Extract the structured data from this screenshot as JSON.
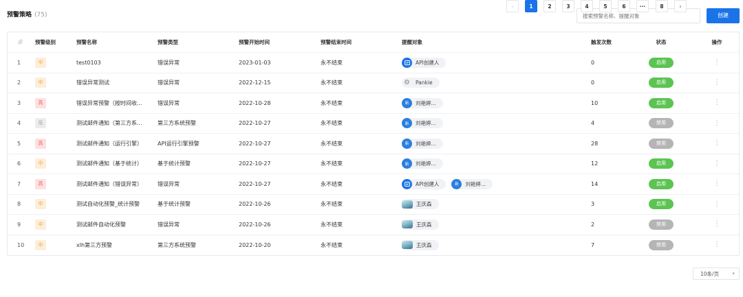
{
  "header": {
    "title": "预警策略",
    "count": "(75)",
    "search_placeholder": "搜索预警名称、提醒对象",
    "create_label": "创建"
  },
  "columns": {
    "index": "#",
    "level": "预警级别",
    "name": "预警名称",
    "type": "预警类型",
    "start": "预警开始时间",
    "end": "预警结束时间",
    "targets": "提醒对象",
    "count": "触发次数",
    "status": "状态",
    "op": "操作"
  },
  "rows": [
    {
      "idx": "1",
      "level": "中",
      "level_kind": "mid",
      "name": "test0103",
      "type": "错误异常",
      "start": "2023-01-03",
      "end": "永不结束",
      "targets": [
        {
          "icon": "api-icon",
          "avatar": "",
          "label": "API创建人"
        }
      ],
      "count": "0",
      "status": "启用",
      "status_kind": "on"
    },
    {
      "idx": "2",
      "level": "中",
      "level_kind": "mid",
      "name": "错误异常测试",
      "type": "错误异常",
      "start": "2022-12-15",
      "end": "永不结束",
      "targets": [
        {
          "icon": "gear-icon",
          "avatar": "",
          "label": "Pankie"
        }
      ],
      "count": "0",
      "status": "启用",
      "status_kind": "on"
    },
    {
      "idx": "3",
      "level": "高",
      "level_kind": "high",
      "name": "错误异常预警（按时间收...",
      "type": "错误异常",
      "start": "2022-10-28",
      "end": "永不结束",
      "targets": [
        {
          "icon": "user-avatar-icon",
          "avatar": "新",
          "label": "刘艳婷..."
        }
      ],
      "count": "10",
      "status": "启用",
      "status_kind": "on"
    },
    {
      "idx": "4",
      "level": "低",
      "level_kind": "low",
      "name": "测试邮件通知（第三方系...",
      "type": "第三方系统预警",
      "start": "2022-10-27",
      "end": "永不结束",
      "targets": [
        {
          "icon": "user-avatar-icon",
          "avatar": "新",
          "label": "刘艳婷..."
        }
      ],
      "count": "4",
      "status": "禁用",
      "status_kind": "off"
    },
    {
      "idx": "5",
      "level": "高",
      "level_kind": "high",
      "name": "测试邮件通知（运行引擎）",
      "type": "API运行引擎预警",
      "start": "2022-10-27",
      "end": "永不结束",
      "targets": [
        {
          "icon": "user-avatar-icon",
          "avatar": "新",
          "label": "刘艳婷..."
        }
      ],
      "count": "28",
      "status": "禁用",
      "status_kind": "off"
    },
    {
      "idx": "6",
      "level": "中",
      "level_kind": "mid",
      "name": "测试邮件通知（基于统计）",
      "type": "基于统计预警",
      "start": "2022-10-27",
      "end": "永不结束",
      "targets": [
        {
          "icon": "user-avatar-icon",
          "avatar": "新",
          "label": "刘艳婷..."
        }
      ],
      "count": "12",
      "status": "启用",
      "status_kind": "on"
    },
    {
      "idx": "7",
      "level": "高",
      "level_kind": "high",
      "name": "测试邮件通知（错误异常）",
      "type": "错误异常",
      "start": "2022-10-27",
      "end": "永不结束",
      "targets": [
        {
          "icon": "api-icon",
          "avatar": "",
          "label": "API创建人"
        },
        {
          "icon": "user-avatar-icon",
          "avatar": "新",
          "label": "刘艳婷..."
        }
      ],
      "count": "14",
      "status": "启用",
      "status_kind": "on"
    },
    {
      "idx": "8",
      "level": "中",
      "level_kind": "mid",
      "name": "测试自动化预警_统计预警",
      "type": "基于统计预警",
      "start": "2022-10-26",
      "end": "永不结束",
      "targets": [
        {
          "icon": "photo-avatar-icon",
          "avatar": "",
          "label": "王庆森"
        }
      ],
      "count": "3",
      "status": "启用",
      "status_kind": "on"
    },
    {
      "idx": "9",
      "level": "中",
      "level_kind": "mid",
      "name": "测试邮件自动化预警",
      "type": "错误异常",
      "start": "2022-10-26",
      "end": "永不结束",
      "targets": [
        {
          "icon": "photo-avatar-icon",
          "avatar": "",
          "label": "王庆森"
        }
      ],
      "count": "2",
      "status": "禁用",
      "status_kind": "off"
    },
    {
      "idx": "10",
      "level": "中",
      "level_kind": "mid",
      "name": "xlh第三方预警",
      "type": "第三方系统预警",
      "start": "2022-10-20",
      "end": "永不结束",
      "targets": [
        {
          "icon": "photo-avatar-icon",
          "avatar": "",
          "label": "王庆森"
        }
      ],
      "count": "7",
      "status": "禁用",
      "status_kind": "off"
    }
  ],
  "pagination": {
    "prev": "‹",
    "pages": [
      "1",
      "2",
      "3",
      "4",
      "5",
      "6",
      "···",
      "8"
    ],
    "active": "1",
    "next": "›",
    "page_size": "10条/页"
  },
  "colors": {
    "accent": "#1a73e8",
    "enabled": "#5cc452",
    "disabled": "#b5b5b5",
    "level_mid": "#f0a34a",
    "level_high": "#ef6262",
    "level_low": "#a3a3a3"
  }
}
